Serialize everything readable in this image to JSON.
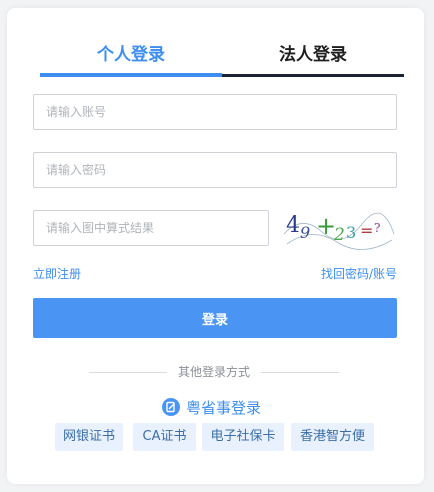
{
  "tabs": {
    "personal": "个人登录",
    "legal": "法人登录"
  },
  "form": {
    "account_placeholder": "请输入账号",
    "password_placeholder": "请输入密码",
    "captcha_placeholder": "请输入图中算式结果"
  },
  "captcha": {
    "parts": [
      "4",
      "9",
      "+",
      "2",
      "3",
      "=",
      "?"
    ]
  },
  "links": {
    "register": "立即注册",
    "recover": "找回密码/账号"
  },
  "login_button": "登录",
  "other_methods": {
    "title": "其他登录方式",
    "yss_label": "粤省事登录",
    "chips": [
      "网银证书",
      "CA证书",
      "电子社保卡",
      "香港智方便"
    ]
  },
  "colors": {
    "accent": "#3d8ef0",
    "button": "#4a95f4",
    "chip_bg": "#e8f1fd"
  }
}
